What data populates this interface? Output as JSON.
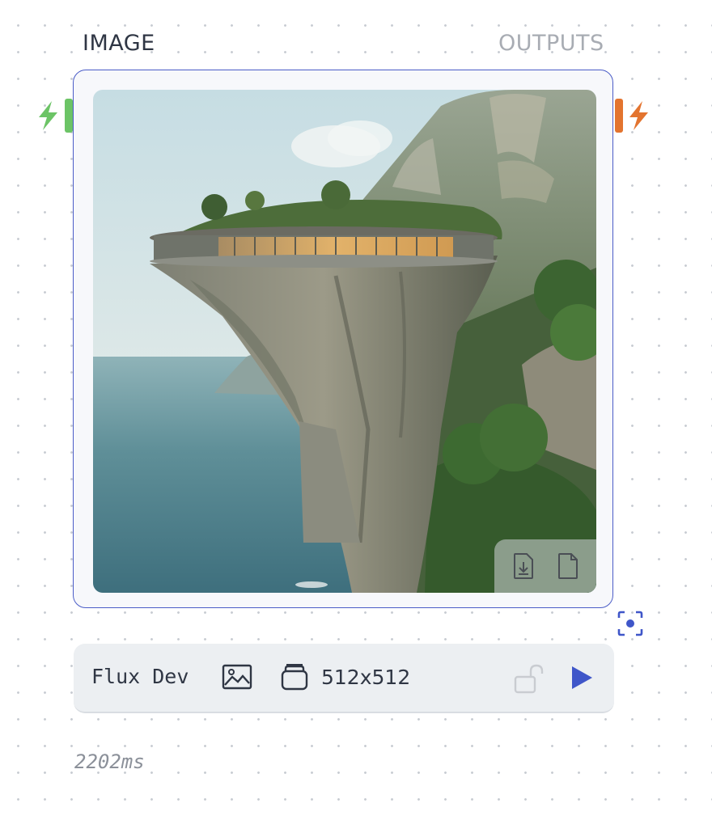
{
  "node": {
    "title": "IMAGE",
    "outputs_label": "OUTPUTS",
    "input_port_icon": "lightning-bolt-icon",
    "output_port_icon": "lightning-bolt-icon",
    "input_port_color": "#6cc466",
    "output_port_color": "#e3742f",
    "border_color": "#4a5cc7"
  },
  "image": {
    "alt": "AI-generated image: cliffside restaurant with a circular glass pavilion perched on a rocky pillar above the sea",
    "actions": [
      {
        "name": "download-icon"
      },
      {
        "name": "file-icon"
      }
    ]
  },
  "focus": {
    "icon": "focus-target-icon"
  },
  "toolbar": {
    "model": "Flux Dev",
    "image_icon": "image-icon",
    "batch_icon": "layers-icon",
    "size": "512x512",
    "seed_lock_icon": "unlock-icon",
    "run_icon": "play-icon",
    "accent": "#3f56c9"
  },
  "duration": "2202ms"
}
